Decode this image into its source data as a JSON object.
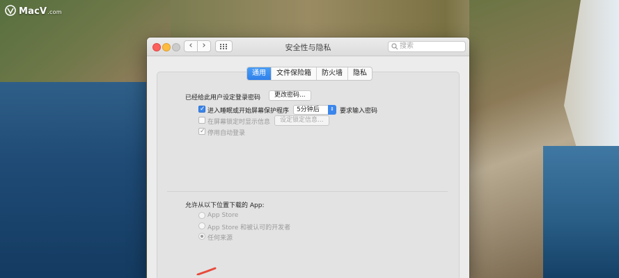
{
  "watermark": {
    "brand": "MacV",
    "suffix": ".com"
  },
  "window": {
    "title": "安全性与隐私",
    "search_placeholder": "搜索",
    "nav_back": "‹",
    "nav_forward": "›"
  },
  "tabs": [
    {
      "label": "通用",
      "active": true
    },
    {
      "label": "文件保险箱",
      "active": false
    },
    {
      "label": "防火墙",
      "active": false
    },
    {
      "label": "隐私",
      "active": false
    }
  ],
  "general": {
    "password_label": "已经给此用户设定登录密码",
    "change_password_button": "更改密码...",
    "require_password_label": "进入睡眠或开始屏幕保护程序",
    "require_password_delay": "5分钟后",
    "require_password_suffix": "要求输入密码",
    "lock_message_label": "在屏幕锁定时显示信息",
    "set_lock_message_button": "设定锁定信息...",
    "disable_autologin_label": "停用自动登录"
  },
  "downloads": {
    "heading": "允许从以下位置下载的 App:",
    "options": [
      {
        "label": "App Store",
        "selected": false
      },
      {
        "label": "App Store 和被认可的开发者",
        "selected": false
      },
      {
        "label": "任何来源",
        "selected": true
      }
    ]
  },
  "colors": {
    "accent": "#3b86ec",
    "annotation": "#e84a3c"
  }
}
